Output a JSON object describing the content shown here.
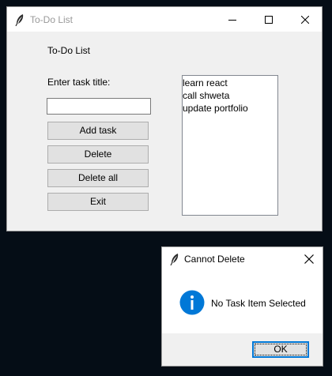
{
  "main_window": {
    "title": "To-Do List",
    "icon": "feather-icon",
    "controls": [
      "minimize-icon",
      "maximize-icon",
      "close-icon"
    ],
    "heading": "To-Do List",
    "task_label": "Enter task title:",
    "task_input": {
      "value": "",
      "placeholder": ""
    },
    "buttons": {
      "add": "Add task",
      "delete": "Delete",
      "delete_all": "Delete all",
      "exit": "Exit"
    },
    "tasks": [
      "learn react",
      "call shweta",
      "update portfolio"
    ]
  },
  "dialog": {
    "title": "Cannot Delete",
    "icon": "feather-icon",
    "message_icon": "info-icon",
    "message": "No Task Item Selected",
    "ok_label": "OK"
  },
  "colors": {
    "desktop": "#050d16",
    "window_bg": "#f0f0f0",
    "button_bg": "#e1e1e1",
    "info_blue": "#0078d7"
  }
}
